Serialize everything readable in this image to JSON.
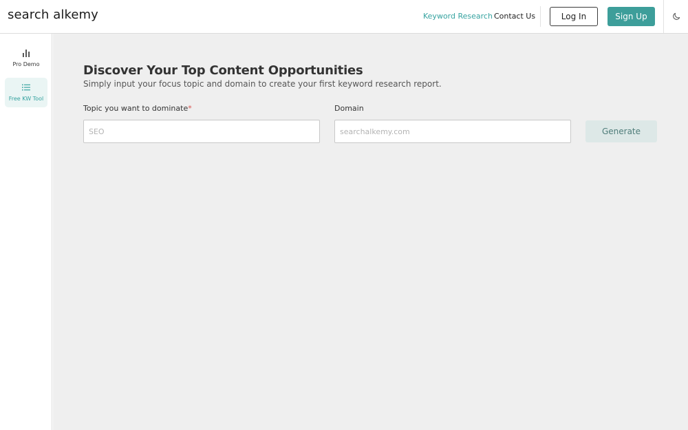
{
  "header": {
    "logo": "search alkemy",
    "nav": {
      "keyword_research": "Keyword Research",
      "contact_us": "Contact Us"
    },
    "login_label": "Log In",
    "signup_label": "Sign Up",
    "theme_icon": "moon-icon"
  },
  "sidebar": {
    "items": [
      {
        "label": "Pro Demo",
        "icon": "bar-chart-icon",
        "active": false
      },
      {
        "label": "Free KW Tool",
        "icon": "list-icon",
        "active": true
      }
    ]
  },
  "main": {
    "title": "Discover Your Top Content Opportunities",
    "subtitle": "Simply input your focus topic and domain to create your first keyword research report.",
    "topic_label": "Topic you want to dominate",
    "required_marker": "*",
    "topic_placeholder": "SEO",
    "topic_value": "",
    "domain_label": "Domain",
    "domain_placeholder": "searchalkemy.com",
    "domain_value": "",
    "generate_label": "Generate"
  },
  "colors": {
    "accent": "#3d9e9a",
    "accent_text": "#36a3a0",
    "main_bg": "#efefef",
    "generate_bg": "#dde8e7",
    "required": "#d9534f"
  }
}
